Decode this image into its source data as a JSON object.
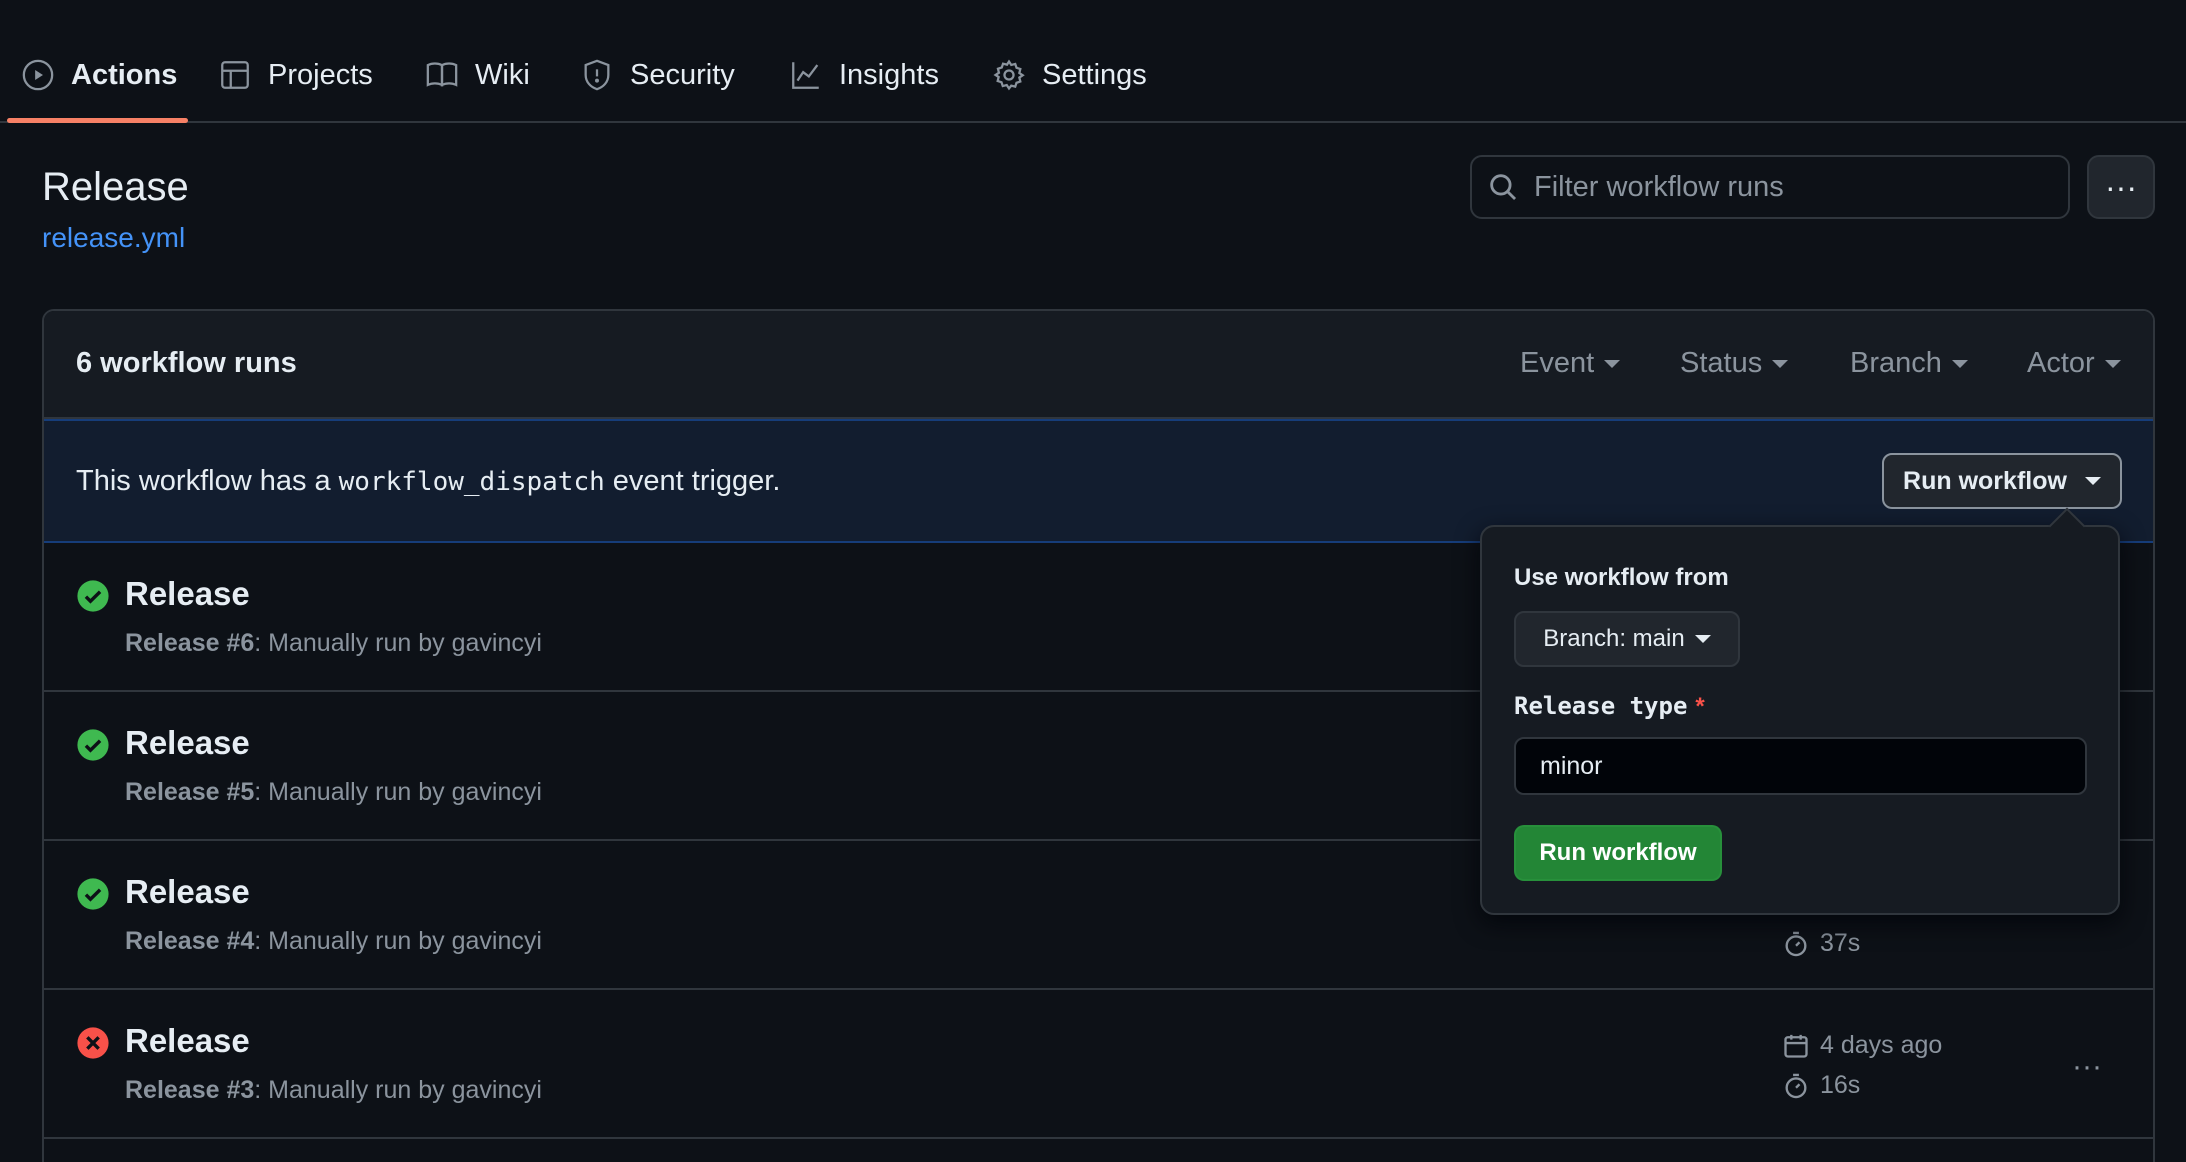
{
  "nav": {
    "tabs": [
      {
        "label": "Actions",
        "icon": "play-icon"
      },
      {
        "label": "Projects",
        "icon": "table-icon"
      },
      {
        "label": "Wiki",
        "icon": "book-icon"
      },
      {
        "label": "Security",
        "icon": "shield-icon"
      },
      {
        "label": "Insights",
        "icon": "graph-icon"
      },
      {
        "label": "Settings",
        "icon": "gear-icon"
      }
    ],
    "active": "Actions"
  },
  "header": {
    "title": "Release",
    "file_link": "release.yml",
    "search_placeholder": "Filter workflow runs"
  },
  "runs": {
    "count_label": "6 workflow runs",
    "filters": [
      "Event",
      "Status",
      "Branch",
      "Actor"
    ],
    "dispatch_prefix": "This workflow has a",
    "dispatch_code": "workflow_dispatch",
    "dispatch_suffix": "event trigger.",
    "run_button": "Run workflow",
    "items": [
      {
        "title": "Release",
        "number": "Release #6",
        "desc": ": Manually run by gavincyi",
        "status": "success"
      },
      {
        "title": "Release",
        "number": "Release #5",
        "desc": ": Manually run by gavincyi",
        "status": "success"
      },
      {
        "title": "Release",
        "number": "Release #4",
        "desc": ": Manually run by gavincyi",
        "status": "success",
        "duration": "37s"
      },
      {
        "title": "Release",
        "number": "Release #3",
        "desc": ": Manually run by gavincyi",
        "status": "failure",
        "date": "4 days ago",
        "duration": "16s"
      }
    ]
  },
  "popover": {
    "use_from_label": "Use workflow from",
    "branch_label": "Branch: main",
    "field_label": "Release type",
    "required_mark": "*",
    "field_value": "minor",
    "submit_label": "Run workflow"
  },
  "colors": {
    "accent": "#f78166",
    "link": "#4493f8",
    "success": "#3fb950",
    "failure": "#f85149",
    "primary_button": "#238636"
  }
}
